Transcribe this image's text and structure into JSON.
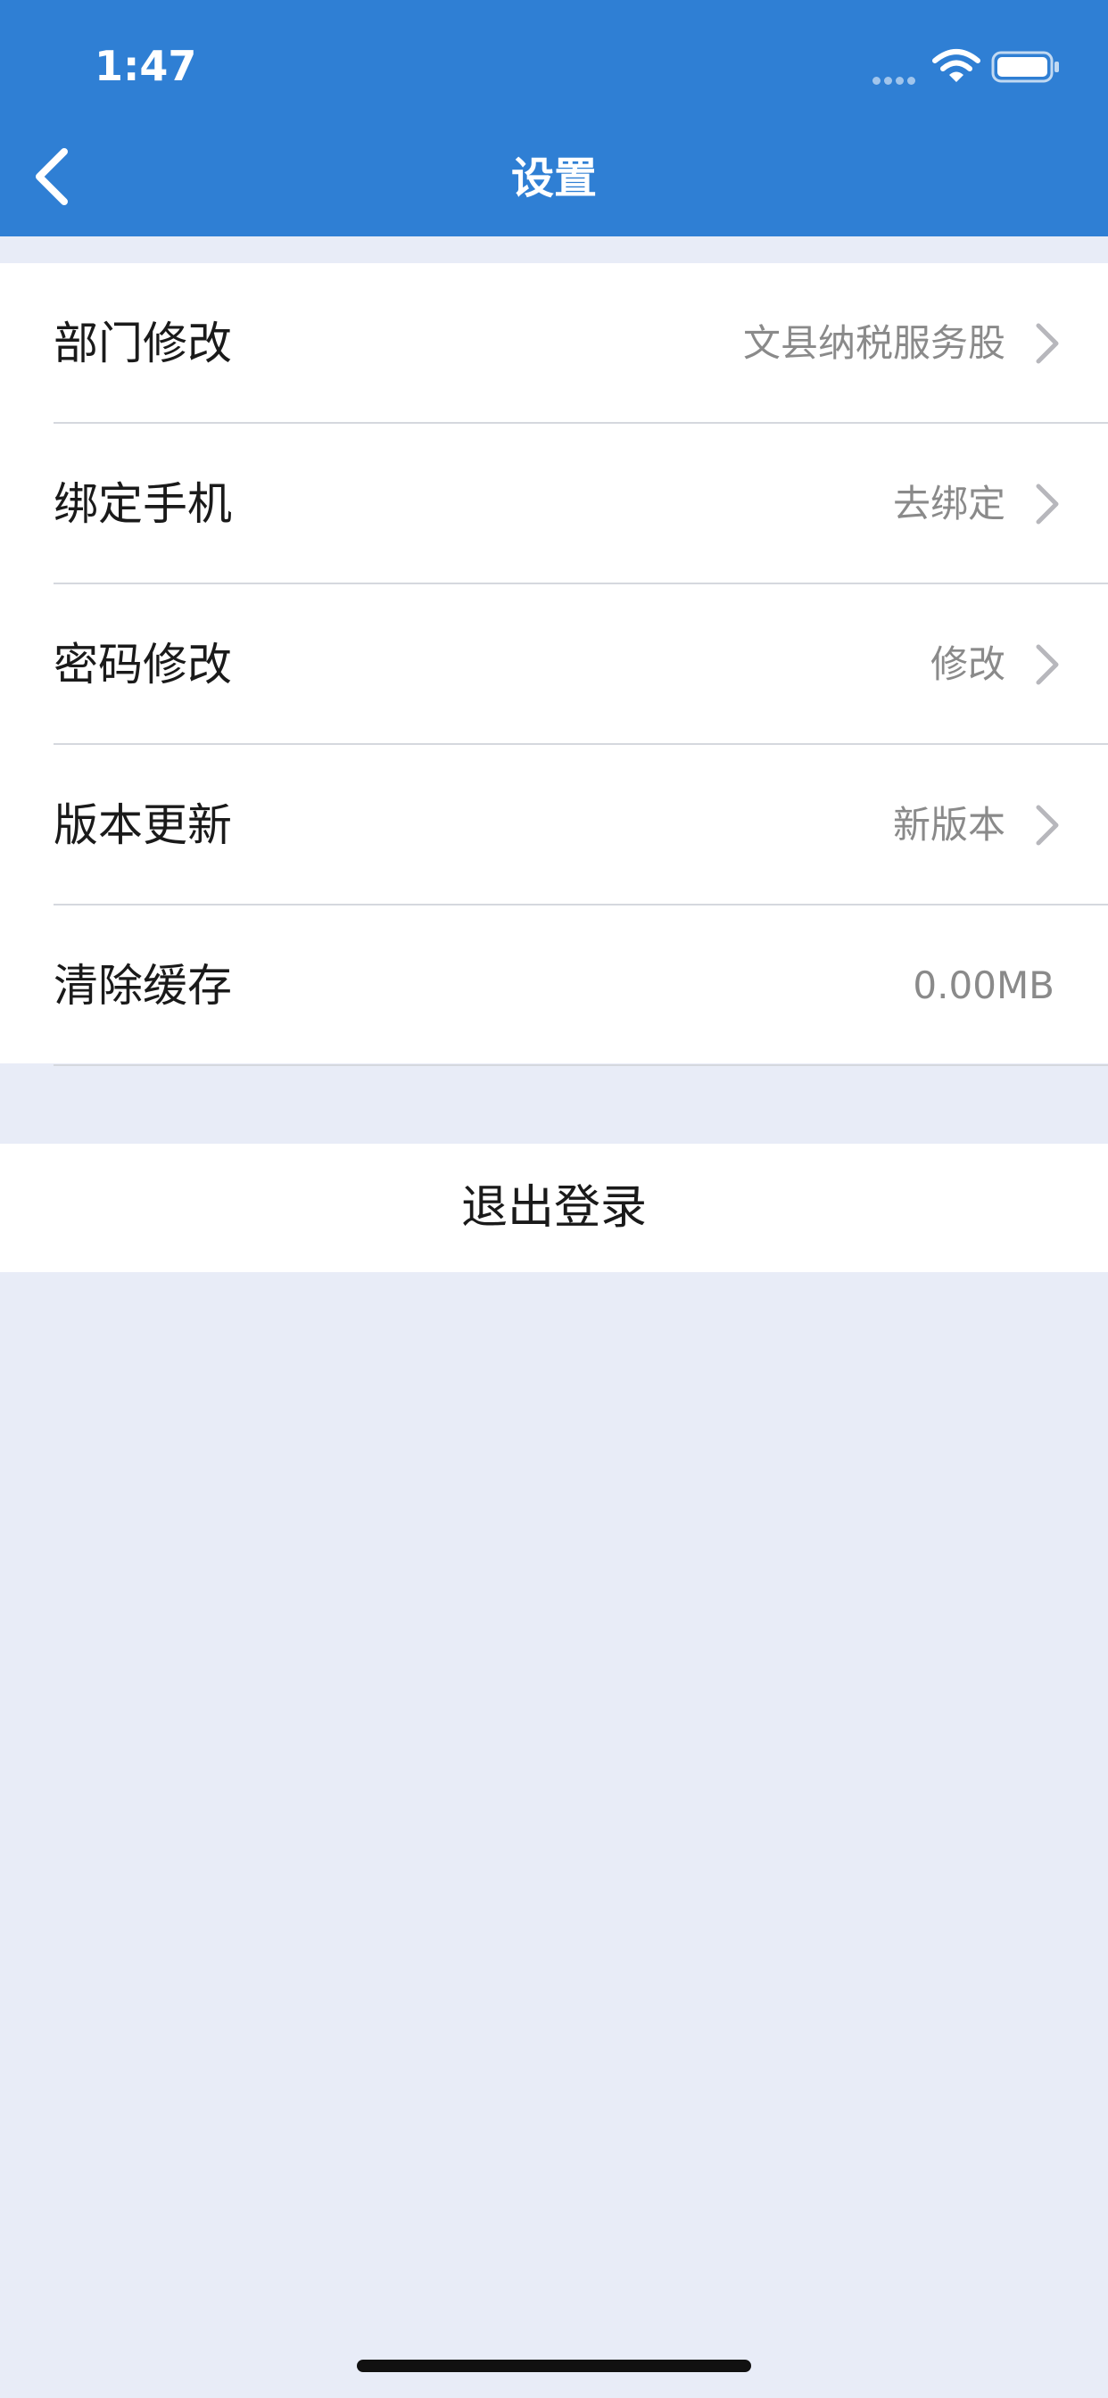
{
  "status_bar": {
    "time": "1:47"
  },
  "nav": {
    "title": "设置",
    "back_icon": "chevron-left-icon"
  },
  "settings": [
    {
      "label": "部门修改",
      "value": "文县纳税服务股",
      "arrow": true
    },
    {
      "label": "绑定手机",
      "value": "去绑定",
      "arrow": true
    },
    {
      "label": "密码修改",
      "value": "修改",
      "arrow": true
    },
    {
      "label": "版本更新",
      "value": "新版本",
      "arrow": true
    },
    {
      "label": "清除缓存",
      "value": "0.00MB",
      "arrow": false
    }
  ],
  "logout": {
    "label": "退出登录"
  },
  "colors": {
    "header": "#2f7fd4",
    "background": "#e8ecf7",
    "secondary_text": "#8a8a8a"
  }
}
